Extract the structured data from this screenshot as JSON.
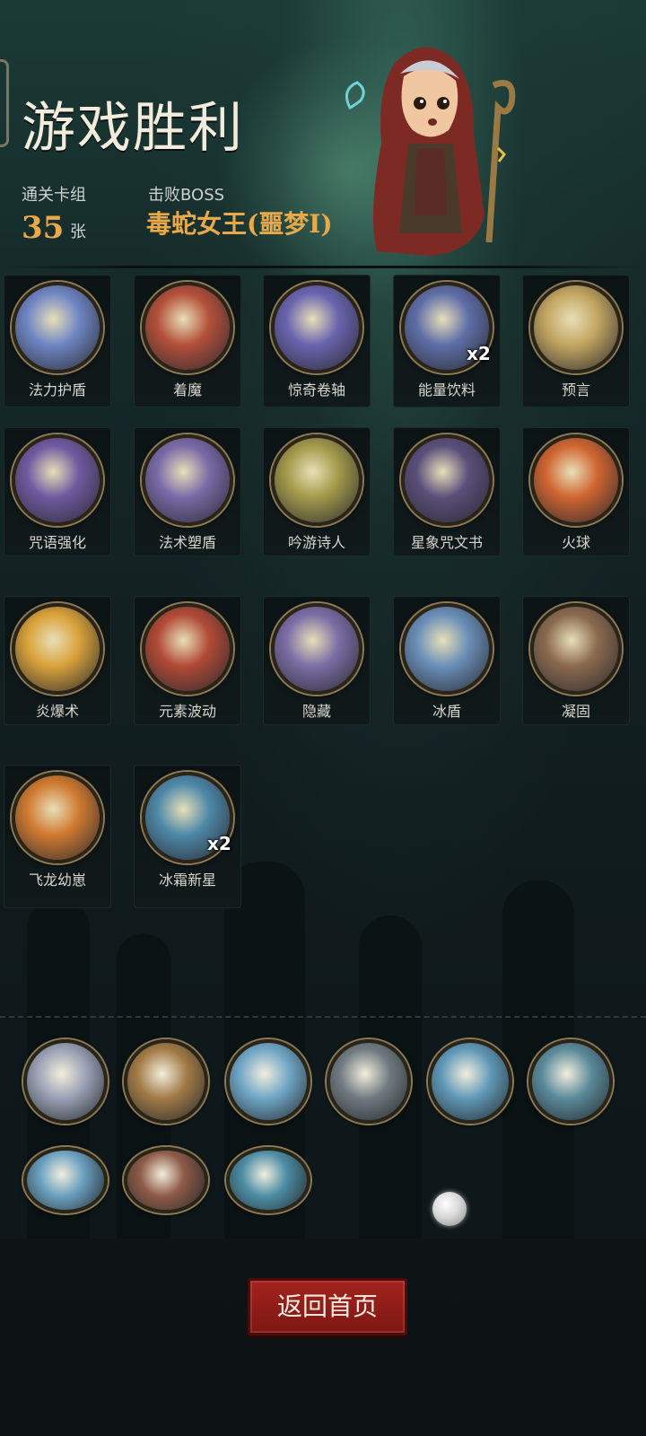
{
  "header": {
    "title": "游戏胜利",
    "deck_label": "通关卡组",
    "deck_count": "35",
    "deck_unit": "张",
    "boss_label": "击败BOSS",
    "boss_name": "毒蛇女王(噩梦I)"
  },
  "cards": [
    {
      "name": "法力护盾",
      "mult": "",
      "color": "#6f86c4"
    },
    {
      "name": "着魔",
      "mult": "",
      "color": "#b4503a"
    },
    {
      "name": "惊奇卷轴",
      "mult": "",
      "color": "#6a64b0"
    },
    {
      "name": "能量饮料",
      "mult": "x2",
      "color": "#5f6ea8"
    },
    {
      "name": "预言",
      "mult": "",
      "color": "#c3a660"
    },
    {
      "name": "咒语强化",
      "mult": "",
      "color": "#6f5aa0"
    },
    {
      "name": "法术塑盾",
      "mult": "",
      "color": "#7a6aa8"
    },
    {
      "name": "吟游诗人",
      "mult": "",
      "color": "#a39a4a"
    },
    {
      "name": "星象咒文书",
      "mult": "",
      "color": "#5a4f7a"
    },
    {
      "name": "火球",
      "mult": "",
      "color": "#d06530"
    },
    {
      "name": "炎爆术",
      "mult": "",
      "color": "#d9a23a"
    },
    {
      "name": "元素波动",
      "mult": "",
      "color": "#b14a36"
    },
    {
      "name": "隐藏",
      "mult": "",
      "color": "#7b6ea6"
    },
    {
      "name": "冰盾",
      "mult": "",
      "color": "#6a8fb8"
    },
    {
      "name": "凝固",
      "mult": "",
      "color": "#8b6a4e"
    },
    {
      "name": "飞龙幼崽",
      "mult": "",
      "color": "#d07a30"
    },
    {
      "name": "冰霜新星",
      "mult": "x2",
      "color": "#4d88a8"
    }
  ],
  "relics": [
    {
      "icon": "mirror-icon",
      "color": "#9aa0b4"
    },
    {
      "icon": "deer-icon",
      "color": "#a27a46"
    },
    {
      "icon": "staff-icon",
      "color": "#6fa6c6"
    },
    {
      "icon": "old-man-icon",
      "color": "#6f7a80"
    },
    {
      "icon": "ice-mage-icon",
      "color": "#5f98b8"
    },
    {
      "icon": "campfire-icon",
      "color": "#5a8a9a"
    },
    {
      "icon": "ice-star-icon",
      "color": "#6aa0c0"
    },
    {
      "icon": "hands-icon",
      "color": "#8e5a48"
    },
    {
      "icon": "water-orb-icon",
      "color": "#4d8ea6"
    }
  ],
  "actions": {
    "home_label": "返回首页"
  },
  "colors": {
    "accent_gold": "#e7a94a",
    "button_red": "#a3231e"
  }
}
